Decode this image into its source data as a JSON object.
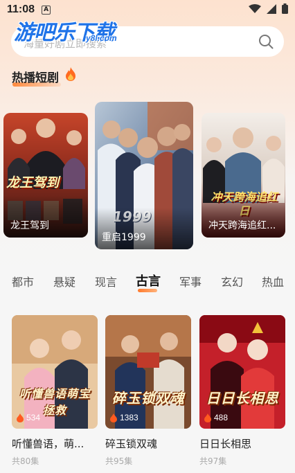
{
  "status": {
    "time": "11:08",
    "notification": "A"
  },
  "brand": {
    "logo": "游吧乐下载",
    "logo_domain": "y8l.com"
  },
  "search": {
    "placeholder": "海量好剧立即搜索"
  },
  "hot_section": {
    "title": "热播短剧",
    "items": [
      {
        "caption": "龙王驾到",
        "poster_text": "龙王驾到"
      },
      {
        "caption": "重启1999",
        "poster_text": "重启1999"
      },
      {
        "caption": "冲天跨海追红...",
        "poster_text": "冲天跨海追红日"
      }
    ]
  },
  "tabs": [
    "都市",
    "悬疑",
    "现言",
    "古言",
    "军事",
    "玄幻",
    "热血"
  ],
  "active_tab": "古言",
  "dramas": [
    {
      "title": "听懂兽语，萌...",
      "poster_text": "听懂兽语萌宝拯救",
      "heat": "534",
      "episodes": "共80集"
    },
    {
      "title": "碎玉锁双魂",
      "poster_text": "碎玉锁双魂",
      "heat": "1383",
      "episodes": "共95集"
    },
    {
      "title": "日日长相思",
      "poster_text": "日日长相思",
      "heat": "488",
      "episodes": "共97集"
    }
  ],
  "colors": {
    "accent": "#ff7a2d",
    "logo_blue": "#1f73e8"
  }
}
